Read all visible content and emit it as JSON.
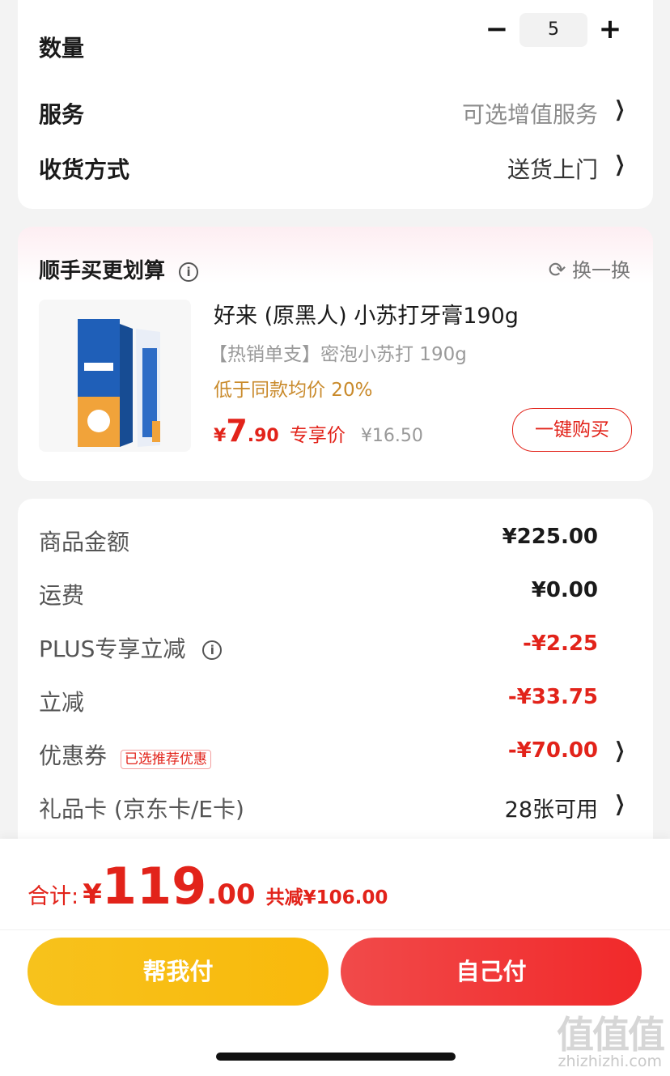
{
  "quantity": {
    "label": "数量",
    "value": "5",
    "minus": "−",
    "plus": "+"
  },
  "service": {
    "label": "服务",
    "value": "可选增值服务"
  },
  "delivery": {
    "label": "收货方式",
    "value": "送货上门"
  },
  "addon": {
    "title": "顺手买更划算",
    "swap_label": "换一换",
    "product": {
      "name": "好来 (原黑人) 小苏打牙膏190g",
      "subtitle": "【热销单支】密泡小苏打 190g",
      "promo": "低于同款均价 20%",
      "price_symbol": "¥",
      "price_int": "7",
      "price_dec": ".90",
      "price_tag": "专享价",
      "orig_price": "¥16.50",
      "buy_button": "一键购买"
    }
  },
  "summary": {
    "goods_label": "商品金额",
    "goods_value": "¥225.00",
    "shipping_label": "运费",
    "shipping_value": "¥0.00",
    "plus_label": "PLUS专享立减",
    "plus_value": "-¥2.25",
    "discount_label": "立减",
    "discount_value": "-¥33.75",
    "coupon_label": "优惠券",
    "coupon_tag": "已选推荐优惠",
    "coupon_value": "-¥70.00",
    "giftcard_label": "礼品卡 (京东卡/E卡)",
    "giftcard_value": "28张可用"
  },
  "total": {
    "label": "合计:",
    "symbol": "¥",
    "int": "119",
    "dec": ".00",
    "saved": "共减¥106.00"
  },
  "actions": {
    "help_pay": "帮我付",
    "self_pay": "自己付"
  },
  "watermark": {
    "text": "值值值",
    "url": "zhizhizhi.com"
  },
  "colors": {
    "accent_red": "#e2231a",
    "promo_orange": "#c98a2b",
    "help_pay_yellow": "#f7c21c",
    "self_pay_red": "#f03a3a"
  }
}
